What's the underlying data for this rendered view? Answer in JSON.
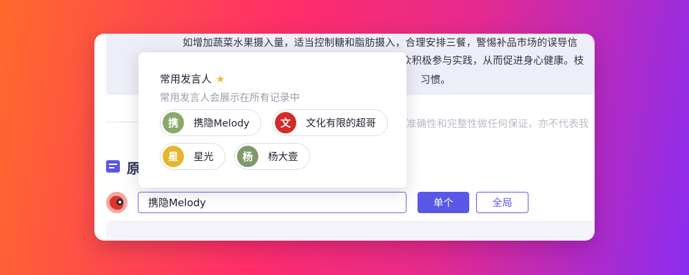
{
  "transcript": {
    "lines": [
      "如增加蔬菜水果摄入量，适当控制糖和脂肪摄入，合理安排三餐，警惕补品市场的误导信",
      "众积极参与实践，从而促进身心健康。枝",
      "习惯。"
    ]
  },
  "disclaimer": "准确性和完整性做任何保证，亦不代表我",
  "section": {
    "title": "原"
  },
  "speaker_input": {
    "value": "携隐Melody"
  },
  "buttons": {
    "single": "单个",
    "global": "全局"
  },
  "popover": {
    "title": "常用发言人",
    "subtitle": "常用发言人会展示在所有记录中",
    "speakers": [
      {
        "avatar": "携",
        "name": "携隐Melody",
        "color": "#8aa86a"
      },
      {
        "avatar": "文",
        "name": "文化有限的超哥",
        "color": "#d42a2a"
      },
      {
        "avatar": "星",
        "name": "星光",
        "color": "#e6b52a"
      },
      {
        "avatar": "杨",
        "name": "杨大壹",
        "color": "#7e9a6a"
      }
    ]
  },
  "icons": {
    "title_star": "star-icon",
    "section": "document-icon",
    "avatar": "parrot-avatar"
  },
  "colors": {
    "accent": "#5a56e6"
  }
}
